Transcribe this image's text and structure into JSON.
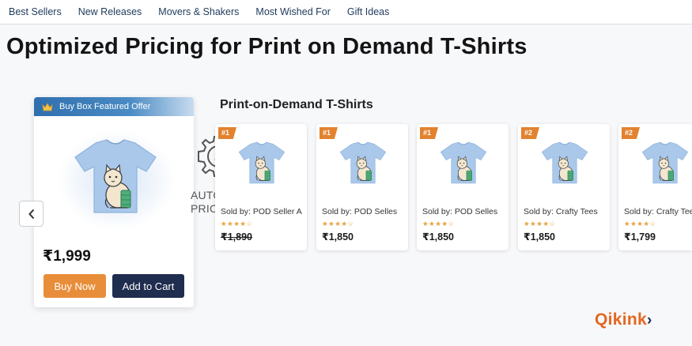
{
  "nav": {
    "items": [
      "Best Sellers",
      "New Releases",
      "Movers & Shakers",
      "Most Wished For",
      "Gift Ideas"
    ]
  },
  "page_title": "Optimized Pricing for Print on Demand T-Shirts",
  "featured": {
    "header": "Buy Box Featured Offer",
    "price": "₹1,999",
    "buy_label": "Buy Now",
    "cart_label": "Add to Cart"
  },
  "automated_pricing": {
    "label": "AUTOMATED PRICING"
  },
  "section_title": "Print-on-Demand T-Shirts",
  "products": [
    {
      "rank": "#1",
      "seller": "Sold by: POD Seller A",
      "stars": "★★★★☆",
      "price": "₹1,890",
      "strikethrough": true
    },
    {
      "rank": "#1",
      "seller": "Sold by: POD Selles",
      "stars": "★★★★☆",
      "price": "₹1,850",
      "strikethrough": false
    },
    {
      "rank": "#1",
      "seller": "Sold by: POD Selles",
      "stars": "★★★★☆",
      "price": "₹1,850",
      "strikethrough": false
    },
    {
      "rank": "#2",
      "seller": "Sold by: Crafty Tees",
      "stars": "★★★★☆",
      "price": "₹1,850",
      "strikethrough": false
    },
    {
      "rank": "#2",
      "seller": "Sold by: Crafty Tees",
      "stars": "★★★★☆",
      "price": "₹1,799",
      "strikethrough": false
    }
  ],
  "logo": {
    "text": "Qikink",
    "chevron": "›"
  },
  "colors": {
    "accent_orange": "#e88e3a",
    "navy": "#1f2d4f",
    "shirt_blue": "#a9c8ea",
    "header_blue": "#2f6fae"
  },
  "icons": {
    "crown": "crown-icon",
    "gear_dollar": "gear-dollar-icon",
    "chevron_left": "chevron-left-icon"
  }
}
